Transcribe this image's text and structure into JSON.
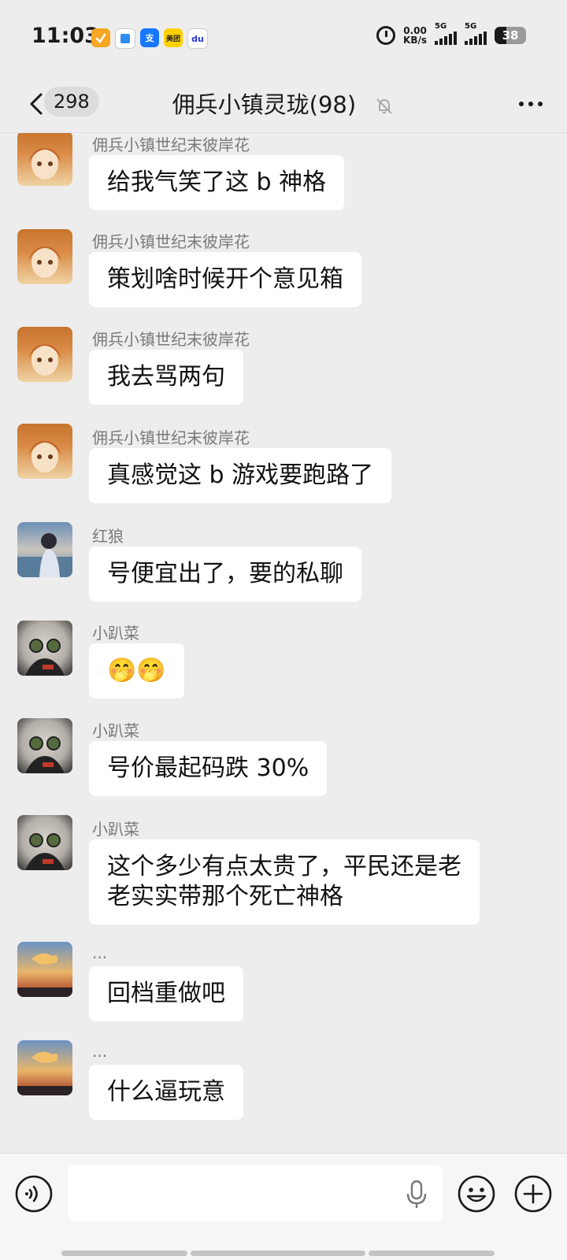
{
  "status_bar": {
    "time": "11:03",
    "notif_icon_3": "支",
    "notif_icon_4": "美团",
    "notif_icon_5": "du",
    "net_speed_value": "0.00",
    "net_speed_unit": "KB/s",
    "sim1_label": "5G",
    "sim2_label": "5G",
    "battery": "38"
  },
  "header": {
    "unread_count": "298",
    "title": "佣兵小镇灵珑(98)"
  },
  "messages": [
    {
      "sender": "佣兵小镇世纪末彼岸花",
      "text": "给我气笑了这 b 神格",
      "avatar": "girl-avatar"
    },
    {
      "sender": "佣兵小镇世纪末彼岸花",
      "text": "策划啥时候开个意见箱",
      "avatar": "girl-avatar"
    },
    {
      "sender": "佣兵小镇世纪末彼岸花",
      "text": "我去骂两句",
      "avatar": "girl-avatar"
    },
    {
      "sender": "佣兵小镇世纪末彼岸花",
      "text": "真感觉这 b 游戏要跑路了",
      "avatar": "girl-avatar"
    },
    {
      "sender": "红狼",
      "text": "号便宜出了，要的私聊",
      "avatar": "boy-avatar"
    },
    {
      "sender": "小趴菜",
      "text": "🤭🤭",
      "avatar": "cat-avatar"
    },
    {
      "sender": "小趴菜",
      "text": "号价最起码跌 30%",
      "avatar": "cat-avatar"
    },
    {
      "sender": "小趴菜",
      "text": "这个多少有点太贵了，平民还是老\n老实实带那个死亡神格",
      "avatar": "cat-avatar"
    },
    {
      "sender": "...",
      "text": "回档重做吧",
      "avatar": "sky-avatar"
    },
    {
      "sender": "...",
      "text": "什么逼玩意",
      "avatar": "sky-avatar"
    }
  ],
  "input": {
    "value": "",
    "placeholder": ""
  },
  "icons": {
    "back": "chevron-left-icon",
    "mute": "bell-off-icon",
    "more": "more-horizontal-icon",
    "voice": "voice-icon",
    "mic": "mic-icon",
    "emoji": "emoji-icon",
    "plus": "plus-icon"
  }
}
